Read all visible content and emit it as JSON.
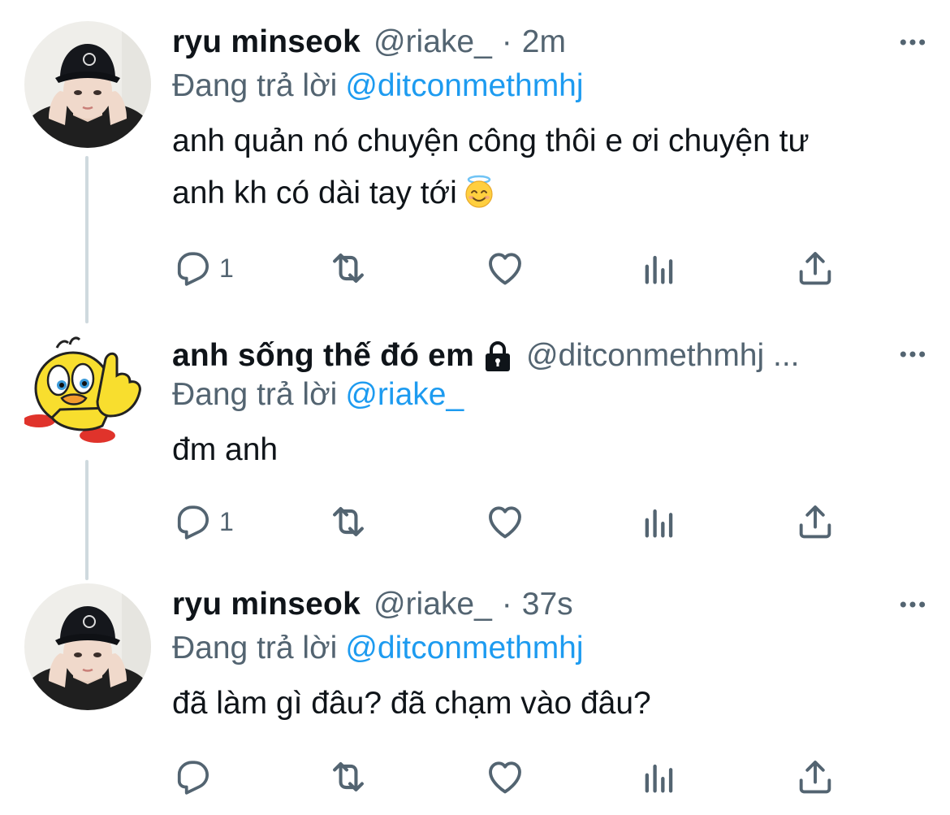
{
  "thread": {
    "tweets": [
      {
        "name": "ryu minseok",
        "handle": "@riake_",
        "separator": "·",
        "time": "2m",
        "replying_prefix": "Đang trả lời",
        "replying_to": "@ditconmethmhj",
        "text_line1": "anh quản nó chuyện công thôi e ơi chuyện tư",
        "text_line2": "anh kh có dài tay tới",
        "emoji": "smiling-face-with-halo",
        "reply_count": "1",
        "avatar": "person-in-black-cap"
      },
      {
        "name": "anh sống thế đó em",
        "protected": true,
        "handle": "@ditconmethmhj ...",
        "replying_prefix": "Đang trả lời",
        "replying_to": "@riake_",
        "text": "đm anh",
        "reply_count": "1",
        "avatar": "yellow-cartoon-bird"
      },
      {
        "name": "ryu minseok",
        "handle": "@riake_",
        "separator": "·",
        "time": "37s",
        "replying_prefix": "Đang trả lời",
        "replying_to": "@ditconmethmhj",
        "text": "đã làm gì đâu? đã chạm vào đâu?",
        "reply_count": "",
        "avatar": "person-in-black-cap"
      }
    ]
  },
  "colors": {
    "text": "#0f1419",
    "secondary": "#536471",
    "link": "#1d9bf0",
    "thread_line": "#cfd9de"
  }
}
